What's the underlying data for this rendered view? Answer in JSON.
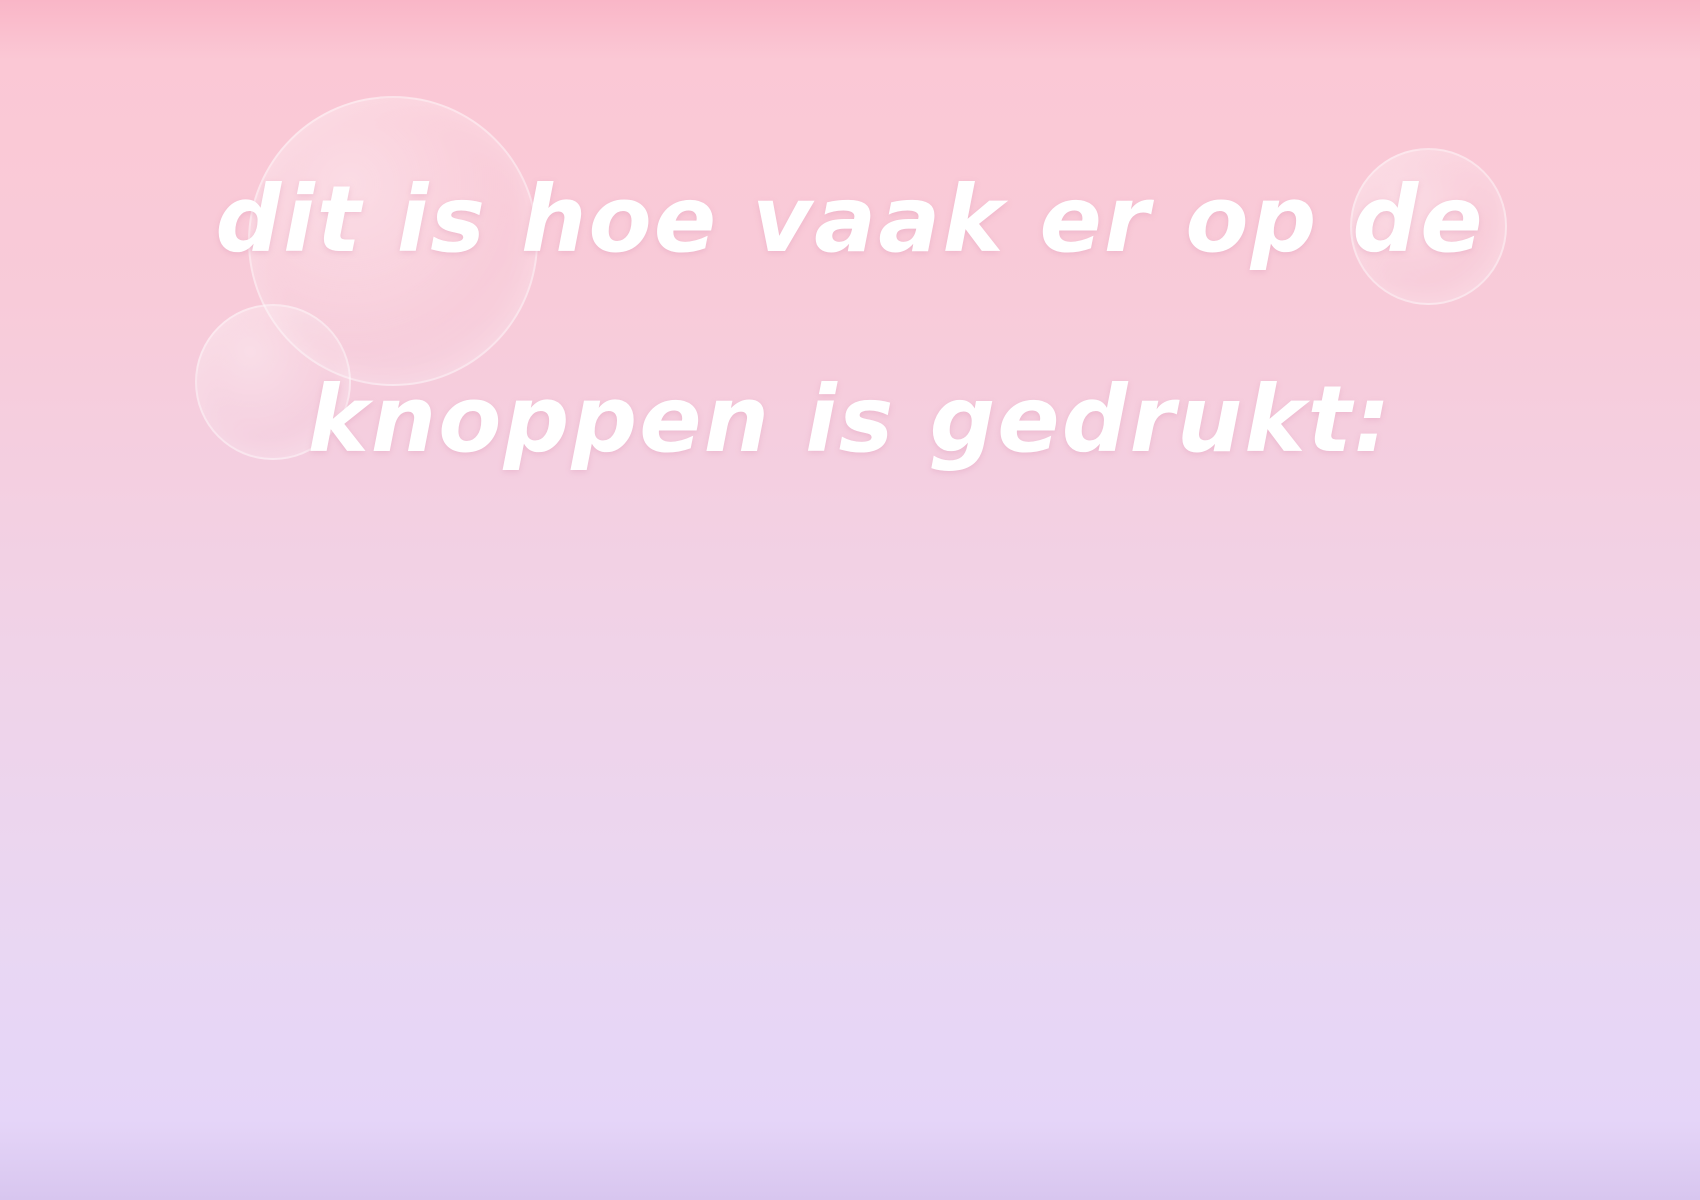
{
  "headline": {
    "line1": "dit is hoe vaak er op de",
    "line2": "knoppen is gedrukt:"
  },
  "colors": {
    "text": "#ffffff",
    "background_top": "#f9b6c7",
    "background_bottom": "#e5d5f8",
    "grid_line": "#ffffff"
  }
}
